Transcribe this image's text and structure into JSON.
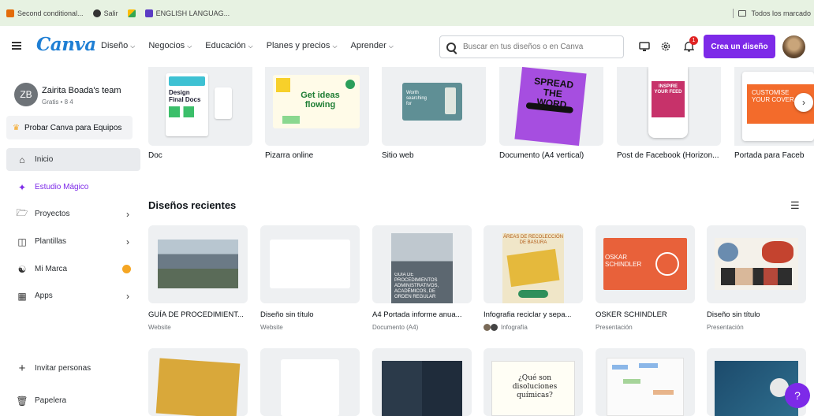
{
  "bookmarks": {
    "items": [
      {
        "label": "Second conditional...",
        "color": "#e36c0a"
      },
      {
        "label": "Salir",
        "color": "#333333"
      },
      {
        "label": "",
        "color": "#34a853"
      },
      {
        "label": "ENGLISH LANGUAG...",
        "color": "#5b3cc4"
      }
    ],
    "all_bookmarks": "Todos los marcado"
  },
  "topnav": {
    "logo": "Canva",
    "nav": [
      "Diseño",
      "Negocios",
      "Educación",
      "Planes y precios",
      "Aprender"
    ],
    "search_placeholder": "Buscar en tus diseños o en Canva",
    "notifications_count": "1",
    "create_label": "Crea un diseño"
  },
  "sidebar": {
    "team_initials": "ZB",
    "team_name": "Zairita Boada's team",
    "team_plan": "Gratis • 8 4",
    "try_teams": "Probar Canva para Equipos",
    "items": [
      {
        "label": "Inicio",
        "icon": "home-icon"
      },
      {
        "label": "Estudio Mágico",
        "icon": "sparkle-icon"
      },
      {
        "label": "Proyectos",
        "icon": "folder-icon"
      },
      {
        "label": "Plantillas",
        "icon": "template-icon"
      },
      {
        "label": "Mi Marca",
        "icon": "brand-icon"
      },
      {
        "label": "Apps",
        "icon": "apps-icon"
      }
    ],
    "invite": "Invitar personas",
    "trash": "Papelera"
  },
  "templates": [
    {
      "label": "Doc"
    },
    {
      "label": "Pizarra online"
    },
    {
      "label": "Sitio web"
    },
    {
      "label": "Documento (A4 vertical)"
    },
    {
      "label": "Post de Facebook (Horizon..."
    },
    {
      "label": "Portada para Faceb"
    }
  ],
  "template_thumbs": {
    "doc_title": "Design Final Docs",
    "pizarra_text": "Get ideas flowing",
    "web_text": "Worth searching for",
    "a4_text": "SPREAD THE WORD",
    "fb_text": "INSPIRE YOUR FEED",
    "cover_text": "CUSTOMISE YOUR COVER"
  },
  "recent": {
    "title": "Diseños recientes",
    "row1": [
      {
        "title": "GUÍA DE PROCEDIMIENT...",
        "sub": "Website"
      },
      {
        "title": "Diseño sin título",
        "sub": "Website"
      },
      {
        "title": "A4 Portada informe anua...",
        "sub": "Documento (A4)"
      },
      {
        "title": "Infografia reciclar y sepa...",
        "sub": "Infografía"
      },
      {
        "title": "OSKER SCHINDLER",
        "sub": "Presentación"
      },
      {
        "title": "Diseño sin título",
        "sub": "Presentación"
      }
    ],
    "row2_texts": {
      "card4": "¿Qué son disoluciones químicas?"
    },
    "thumb_texts": {
      "r1c3": "GUÍA DE PROCEDIMIENTOS ADMINISTRATIVOS, ACADÉMICOS, DE ORDEN REGULAR",
      "r1c4": "ÁREAS DE RECOLECCIÓN DE BASURA",
      "r1c5": "OSKAR SCHINDLER"
    }
  },
  "help": "?"
}
